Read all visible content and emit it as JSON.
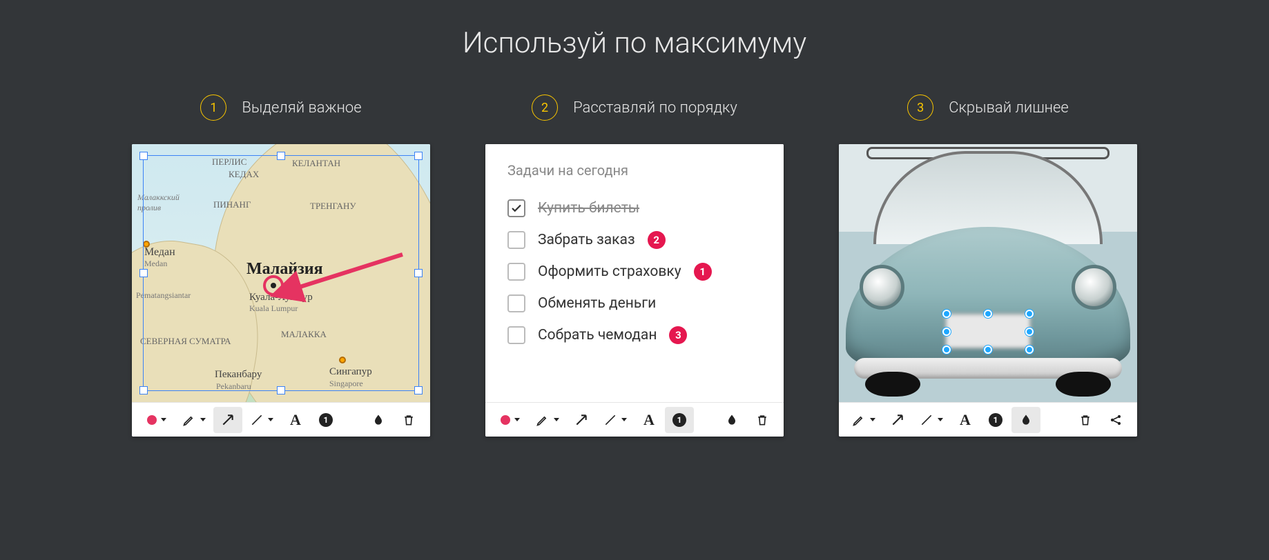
{
  "title": "Используй по максимуму",
  "cards": {
    "c1": {
      "num": "1",
      "label": "Выделяй важное"
    },
    "c2": {
      "num": "2",
      "label": "Расставляй по порядку"
    },
    "c3": {
      "num": "3",
      "label": "Скрывай лишнее"
    }
  },
  "map_labels": {
    "perlis": "ПЕРЛИС",
    "kedah": "КЕДАХ",
    "kelantan": "КЕЛАНТАН",
    "penang": "ПИНАНГ",
    "terengganu": "ТРЕНГАНУ",
    "strait": "Малаккский пролив",
    "medan_ru": "Медан",
    "medan_en": "Medan",
    "pematang": "Pematangsiantar",
    "country": "Малайзия",
    "kl_ru": "Куала-Лумпур",
    "kl_en": "Kuala Lumpur",
    "malacca": "МАЛАККА",
    "n_sumatra": "СЕВЕРНАЯ СУМАТРА",
    "pekanbaru_ru": "Пеканбару",
    "pekanbaru_en": "Pekanbaru",
    "sg_ru": "Сингапур",
    "sg_en": "Singapore"
  },
  "todo": {
    "heading": "Задачи на сегодня",
    "items": [
      {
        "text": "Купить билеты",
        "done": true
      },
      {
        "text": "Забрать заказ",
        "badge": "2"
      },
      {
        "text": "Оформить страховку",
        "badge": "1"
      },
      {
        "text": "Обменять деньги"
      },
      {
        "text": "Собрать чемодан",
        "badge": "3"
      }
    ]
  },
  "tool_glyphs": {
    "text": "A",
    "step": "1"
  },
  "colors": {
    "accent": "#f7c400",
    "pink": "#e53361",
    "badge": "#e5174f"
  }
}
